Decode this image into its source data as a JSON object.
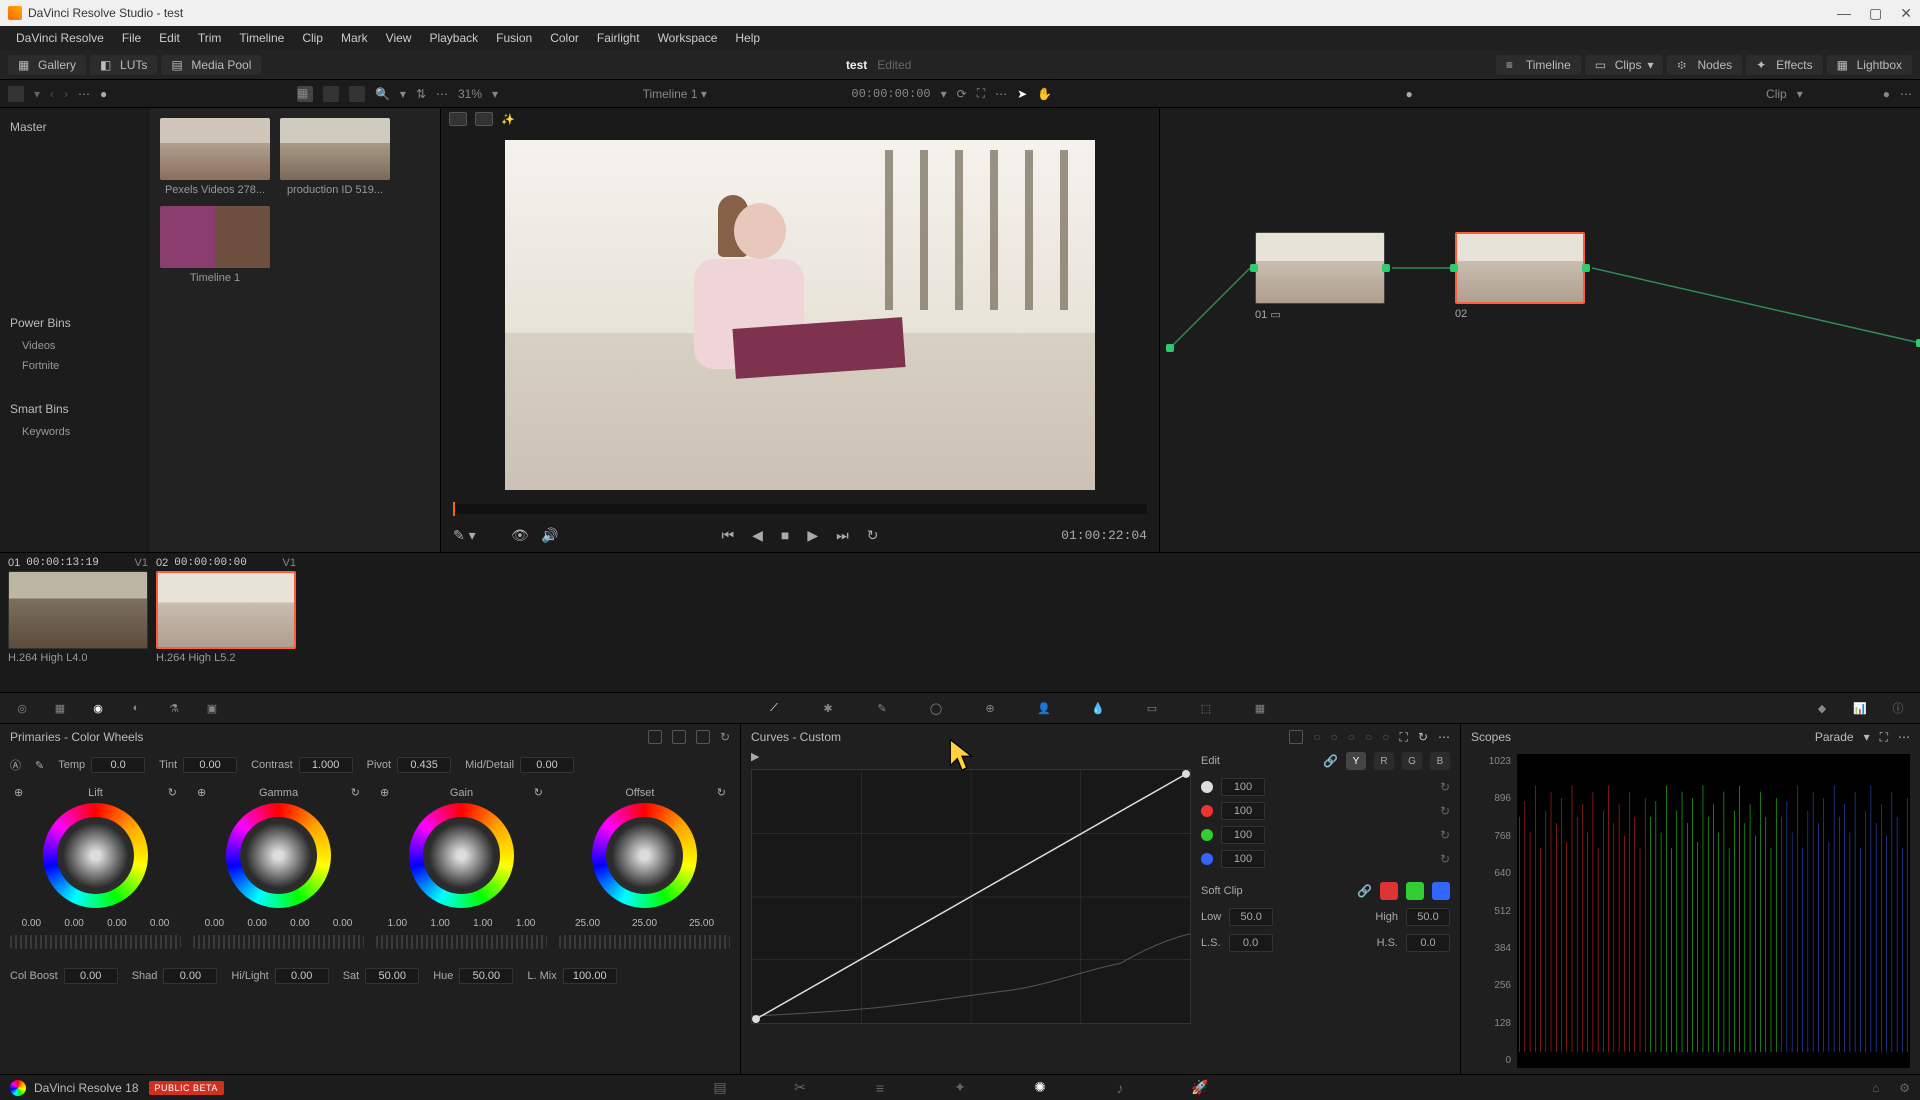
{
  "window": {
    "title": "DaVinci Resolve Studio - test"
  },
  "menu": [
    "DaVinci Resolve",
    "File",
    "Edit",
    "Trim",
    "Timeline",
    "Clip",
    "Mark",
    "View",
    "Playback",
    "Fusion",
    "Color",
    "Fairlight",
    "Workspace",
    "Help"
  ],
  "toptools": {
    "gallery": "Gallery",
    "luts": "LUTs",
    "mediapool": "Media Pool",
    "project": "test",
    "edited": "Edited",
    "timeline": "Timeline",
    "clips": "Clips",
    "nodesLabel": "Nodes",
    "effects": "Effects",
    "lightbox": "Lightbox"
  },
  "secbar": {
    "zoom": "31%",
    "timelineName": "Timeline 1",
    "timecode": "00:00:00:00",
    "clipLabel": "Clip"
  },
  "sidebar": {
    "master": "Master",
    "powerbins": "Power Bins",
    "items": [
      "Videos",
      "Fortnite"
    ],
    "smartbins": "Smart Bins",
    "keywords": "Keywords"
  },
  "media": {
    "items": [
      {
        "label": "Pexels Videos 278..."
      },
      {
        "label": "production ID 519..."
      },
      {
        "label": "Timeline 1"
      }
    ]
  },
  "viewer": {
    "duration": "01:00:22:04"
  },
  "nodes": {
    "n1": "01",
    "n2": "02"
  },
  "tlclips": [
    {
      "num": "01",
      "tc": "00:00:13:19",
      "track": "V1",
      "codec": "H.264 High L4.0"
    },
    {
      "num": "02",
      "tc": "00:00:00:00",
      "track": "V1",
      "codec": "H.264 High L5.2"
    }
  ],
  "primaries": {
    "title": "Primaries - Color Wheels",
    "adj": {
      "temp": {
        "label": "Temp",
        "value": "0.0"
      },
      "tint": {
        "label": "Tint",
        "value": "0.00"
      },
      "contrast": {
        "label": "Contrast",
        "value": "1.000"
      },
      "pivot": {
        "label": "Pivot",
        "value": "0.435"
      },
      "middetail": {
        "label": "Mid/Detail",
        "value": "0.00"
      }
    },
    "wheels": {
      "lift": {
        "label": "Lift",
        "vals": [
          "0.00",
          "0.00",
          "0.00",
          "0.00"
        ]
      },
      "gamma": {
        "label": "Gamma",
        "vals": [
          "0.00",
          "0.00",
          "0.00",
          "0.00"
        ]
      },
      "gain": {
        "label": "Gain",
        "vals": [
          "1.00",
          "1.00",
          "1.00",
          "1.00"
        ]
      },
      "offset": {
        "label": "Offset",
        "vals": [
          "25.00",
          "25.00",
          "25.00"
        ]
      }
    },
    "bottom": {
      "colboost": {
        "label": "Col Boost",
        "value": "0.00"
      },
      "shad": {
        "label": "Shad",
        "value": "0.00"
      },
      "hilight": {
        "label": "Hi/Light",
        "value": "0.00"
      },
      "sat": {
        "label": "Sat",
        "value": "50.00"
      },
      "hue": {
        "label": "Hue",
        "value": "50.00"
      },
      "lmix": {
        "label": "L. Mix",
        "value": "100.00"
      }
    }
  },
  "curves": {
    "title": "Curves - Custom",
    "edit": "Edit",
    "channels": {
      "y": "Y",
      "r": "R",
      "g": "G",
      "b": "B"
    },
    "intensity": {
      "w": "100",
      "r": "100",
      "g": "100",
      "b": "100"
    },
    "softclip": {
      "label": "Soft Clip",
      "low": {
        "label": "Low",
        "value": "50.0"
      },
      "high": {
        "label": "High",
        "value": "50.0"
      },
      "ls": {
        "label": "L.S.",
        "value": "0.0"
      },
      "hs": {
        "label": "H.S.",
        "value": "0.0"
      }
    }
  },
  "scopes": {
    "title": "Scopes",
    "mode": "Parade",
    "scale": [
      "1023",
      "896",
      "768",
      "640",
      "512",
      "384",
      "256",
      "128",
      "0"
    ]
  },
  "status": {
    "app": "DaVinci Resolve 18",
    "beta": "PUBLIC BETA"
  }
}
